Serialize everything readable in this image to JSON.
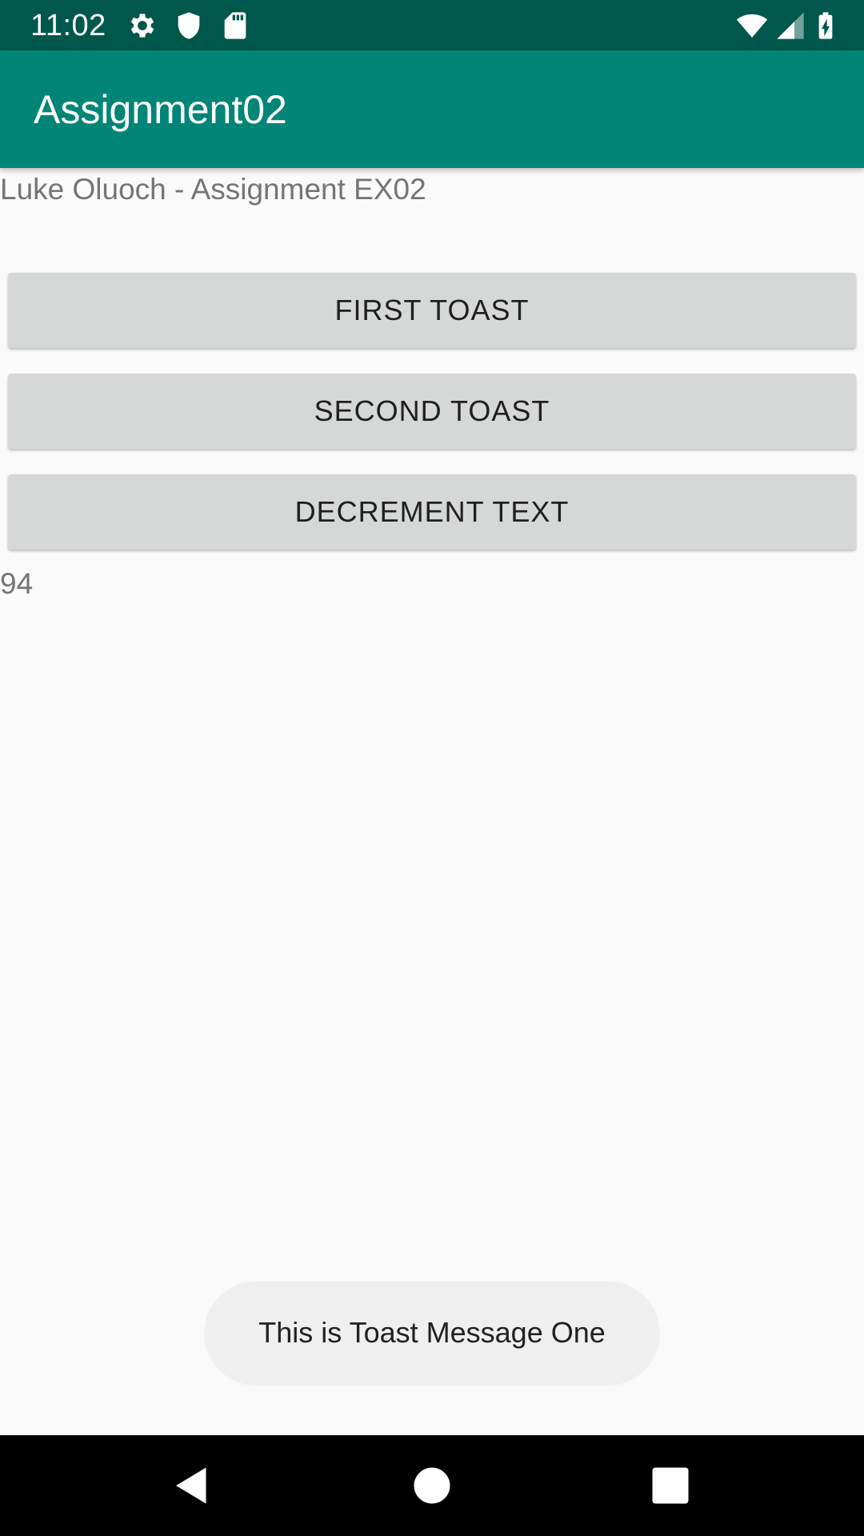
{
  "status_bar": {
    "time": "11:02",
    "background_color": "#00574b",
    "icons": [
      "gear-icon",
      "shield-icon",
      "sd-card-icon",
      "wifi-icon",
      "cell-signal-icon",
      "battery-charging-icon"
    ]
  },
  "app_bar": {
    "title": "Assignment02",
    "background_color": "#008577"
  },
  "main": {
    "subtitle": "Luke Oluoch - Assignment EX02",
    "buttons": {
      "first_toast": "FIRST TOAST",
      "second_toast": "SECOND TOAST",
      "decrement_text": "DECREMENT TEXT"
    },
    "counter": "94"
  },
  "toast": {
    "message": "This is Toast Message One"
  },
  "nav_bar": {
    "icons": [
      "back-icon",
      "home-icon",
      "recents-icon"
    ]
  }
}
